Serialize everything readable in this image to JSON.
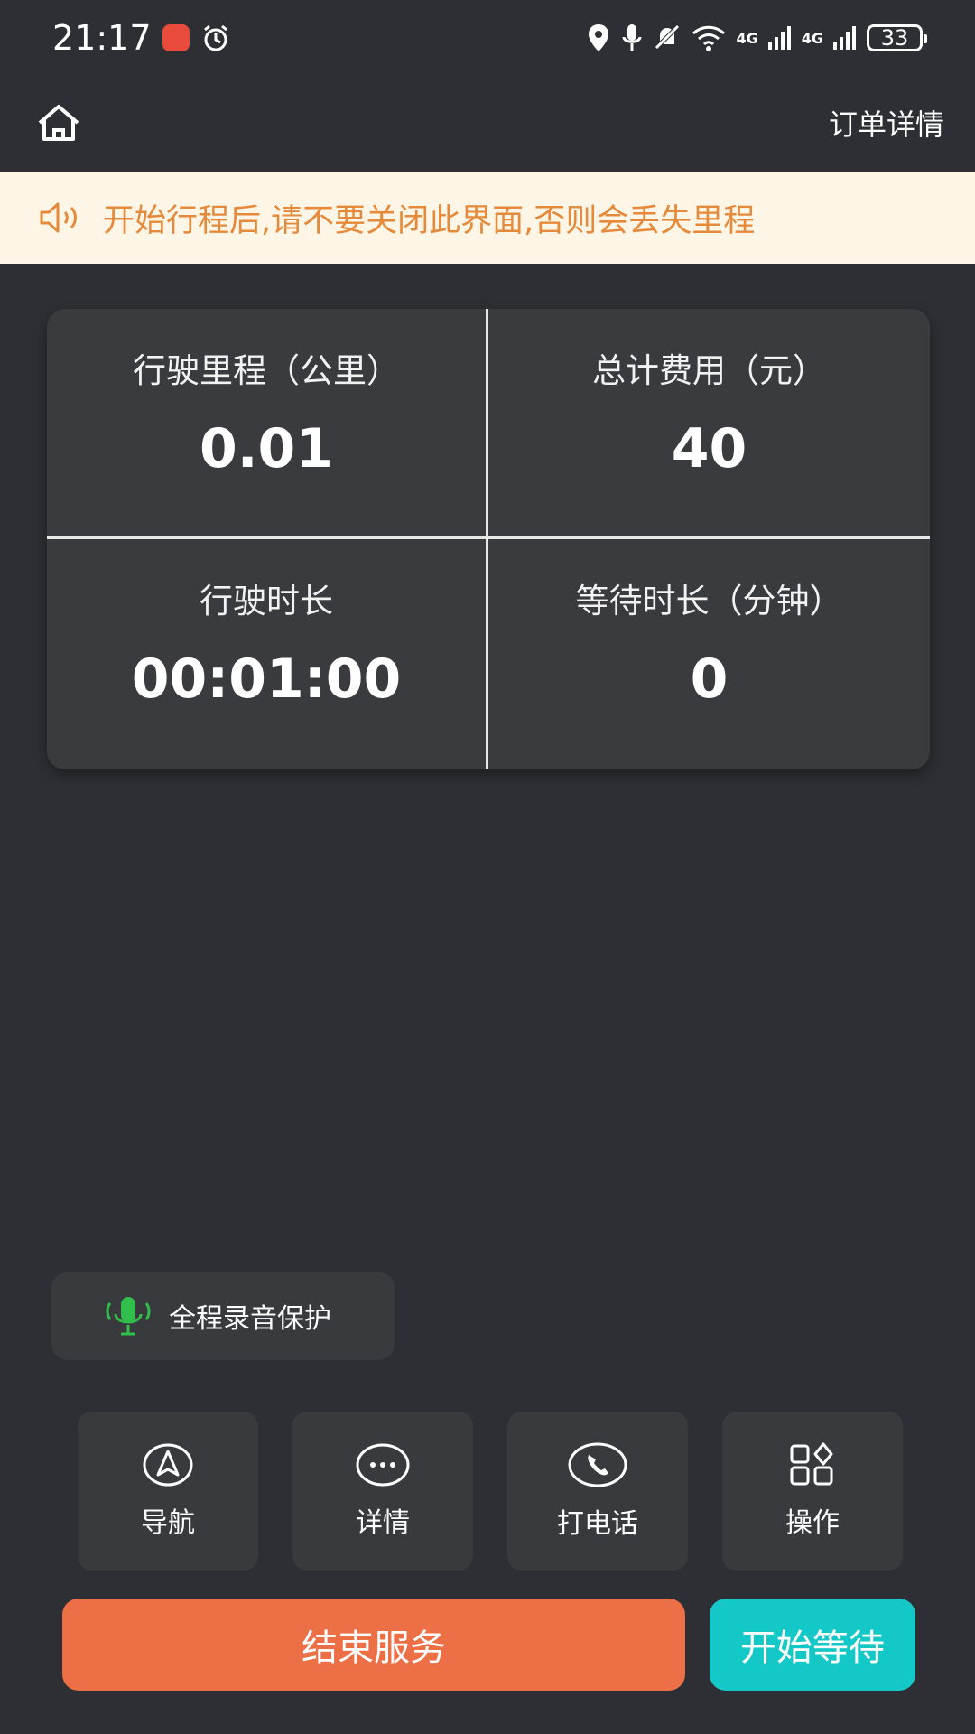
{
  "status_bar": {
    "time": "21:17",
    "network_1": "4G",
    "network_2": "4G",
    "battery": "33"
  },
  "header": {
    "title": "订单详情"
  },
  "notice": {
    "text": "开始行程后,请不要关闭此界面,否则会丢失里程"
  },
  "stats": {
    "distance_label": "行驶里程（公里）",
    "distance_value": "0.01",
    "fee_label": "总计费用（元）",
    "fee_value": "40",
    "duration_label": "行驶时长",
    "duration_value": "00:01:00",
    "wait_label": "等待时长（分钟）",
    "wait_value": "0"
  },
  "recording": {
    "label": "全程录音保护"
  },
  "actions": {
    "navigate": "导航",
    "details": "详情",
    "call": "打电话",
    "operate": "操作"
  },
  "buttons": {
    "end_service": "结束服务",
    "start_wait": "开始等待"
  },
  "colors": {
    "background": "#2d2f34",
    "notice_bg": "#fdf5e6",
    "notice_text": "#e58a3a",
    "end_button": "#ec6f45",
    "wait_button": "#15c8c8",
    "mic_green": "#2fbf4a"
  }
}
